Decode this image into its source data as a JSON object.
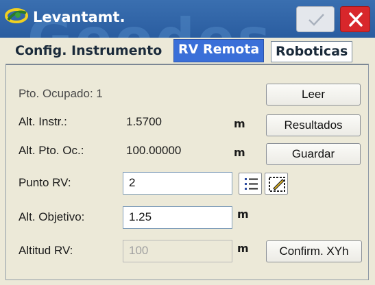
{
  "window": {
    "title": "Levantamt.",
    "watermark": "Geodes"
  },
  "tabs": [
    {
      "label": "Config. Instrumento",
      "active": false
    },
    {
      "label": "RV Remota",
      "active": true
    },
    {
      "label": "Roboticas",
      "active": false
    }
  ],
  "form": {
    "pto_ocupado": {
      "label": "Pto. Ocupado: 1"
    },
    "alt_instr": {
      "label": "Alt. Instr.:",
      "value": "1.5700",
      "unit": "m"
    },
    "alt_pto_oc": {
      "label": "Alt. Pto. Oc.:",
      "value": "100.00000",
      "unit": "m"
    },
    "punto_rv": {
      "label": "Punto RV:",
      "value": "2"
    },
    "alt_objetivo": {
      "label": "Alt. Objetivo:",
      "value": "1.25",
      "unit": "m"
    },
    "altitud_rv": {
      "label": "Altitud RV:",
      "value": "100",
      "unit": "m"
    }
  },
  "buttons": {
    "leer": "Leer",
    "resultados": "Resultados",
    "guardar": "Guardar",
    "confirm": "Confirm. XYh"
  },
  "colors": {
    "titlebar": "#2a5da0",
    "active_tab": "#3a6fd8",
    "close": "#d8272b",
    "panel": "#ece9d8"
  }
}
